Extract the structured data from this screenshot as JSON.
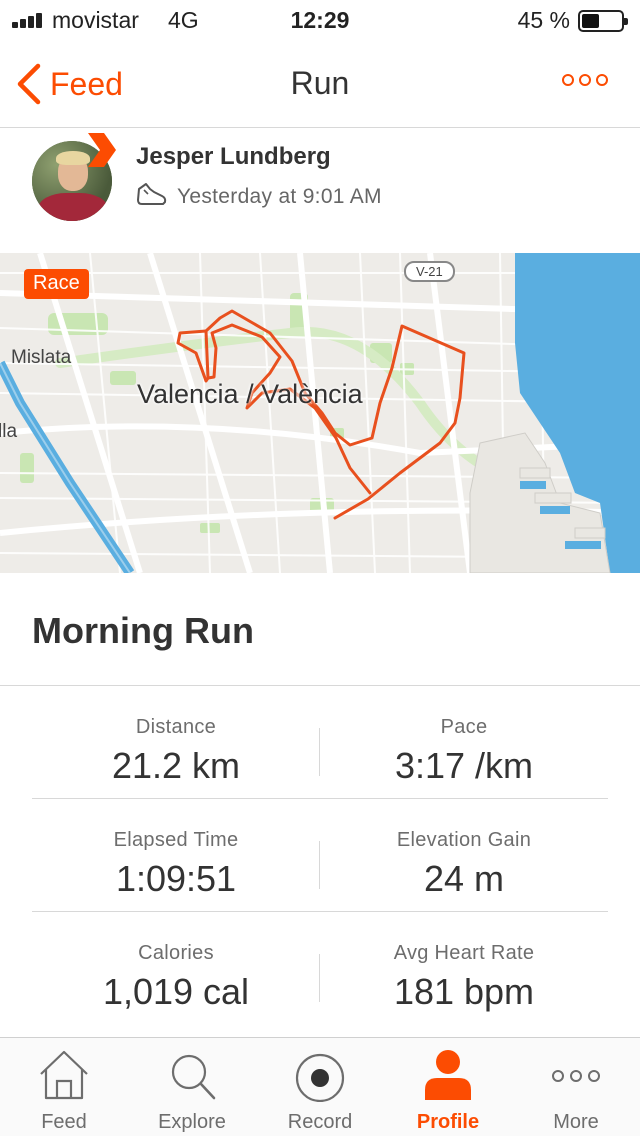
{
  "status_bar": {
    "carrier": "movistar",
    "network": "4G",
    "time": "12:29",
    "battery_percent": "45 %",
    "battery_level": 0.45
  },
  "nav": {
    "back_label": "Feed",
    "title": "Run",
    "more_icon": "more-dots-icon"
  },
  "athlete": {
    "name": "Jesper Lundberg",
    "activity_time": "Yesterday at 9:01 AM",
    "activity_icon": "shoe-icon"
  },
  "map": {
    "badge": "Race",
    "city_label": "Valencia / València",
    "label_west": "Mislata",
    "label_southwest": "lla",
    "road_badge": "V-21",
    "route_color": "#e8501e",
    "water_color": "#5aaee0"
  },
  "activity": {
    "title": "Morning Run"
  },
  "stats": [
    {
      "left": {
        "label": "Distance",
        "value": "21.2 km"
      },
      "right": {
        "label": "Pace",
        "value": "3:17 /km"
      }
    },
    {
      "left": {
        "label": "Elapsed Time",
        "value": "1:09:51"
      },
      "right": {
        "label": "Elevation Gain",
        "value": "24 m"
      }
    },
    {
      "left": {
        "label": "Calories",
        "value": "1,019 cal"
      },
      "right": {
        "label": "Avg Heart Rate",
        "value": "181 bpm"
      }
    }
  ],
  "tabs": [
    {
      "label": "Feed",
      "icon": "home-icon",
      "active": false
    },
    {
      "label": "Explore",
      "icon": "search-icon",
      "active": false
    },
    {
      "label": "Record",
      "icon": "record-icon",
      "active": false
    },
    {
      "label": "Profile",
      "icon": "profile-icon",
      "active": true
    },
    {
      "label": "More",
      "icon": "more-dots-icon",
      "active": false
    }
  ],
  "colors": {
    "accent": "#fc4c02",
    "text": "#333333",
    "muted": "#6d6d6d",
    "divider": "#d8d8d8"
  }
}
